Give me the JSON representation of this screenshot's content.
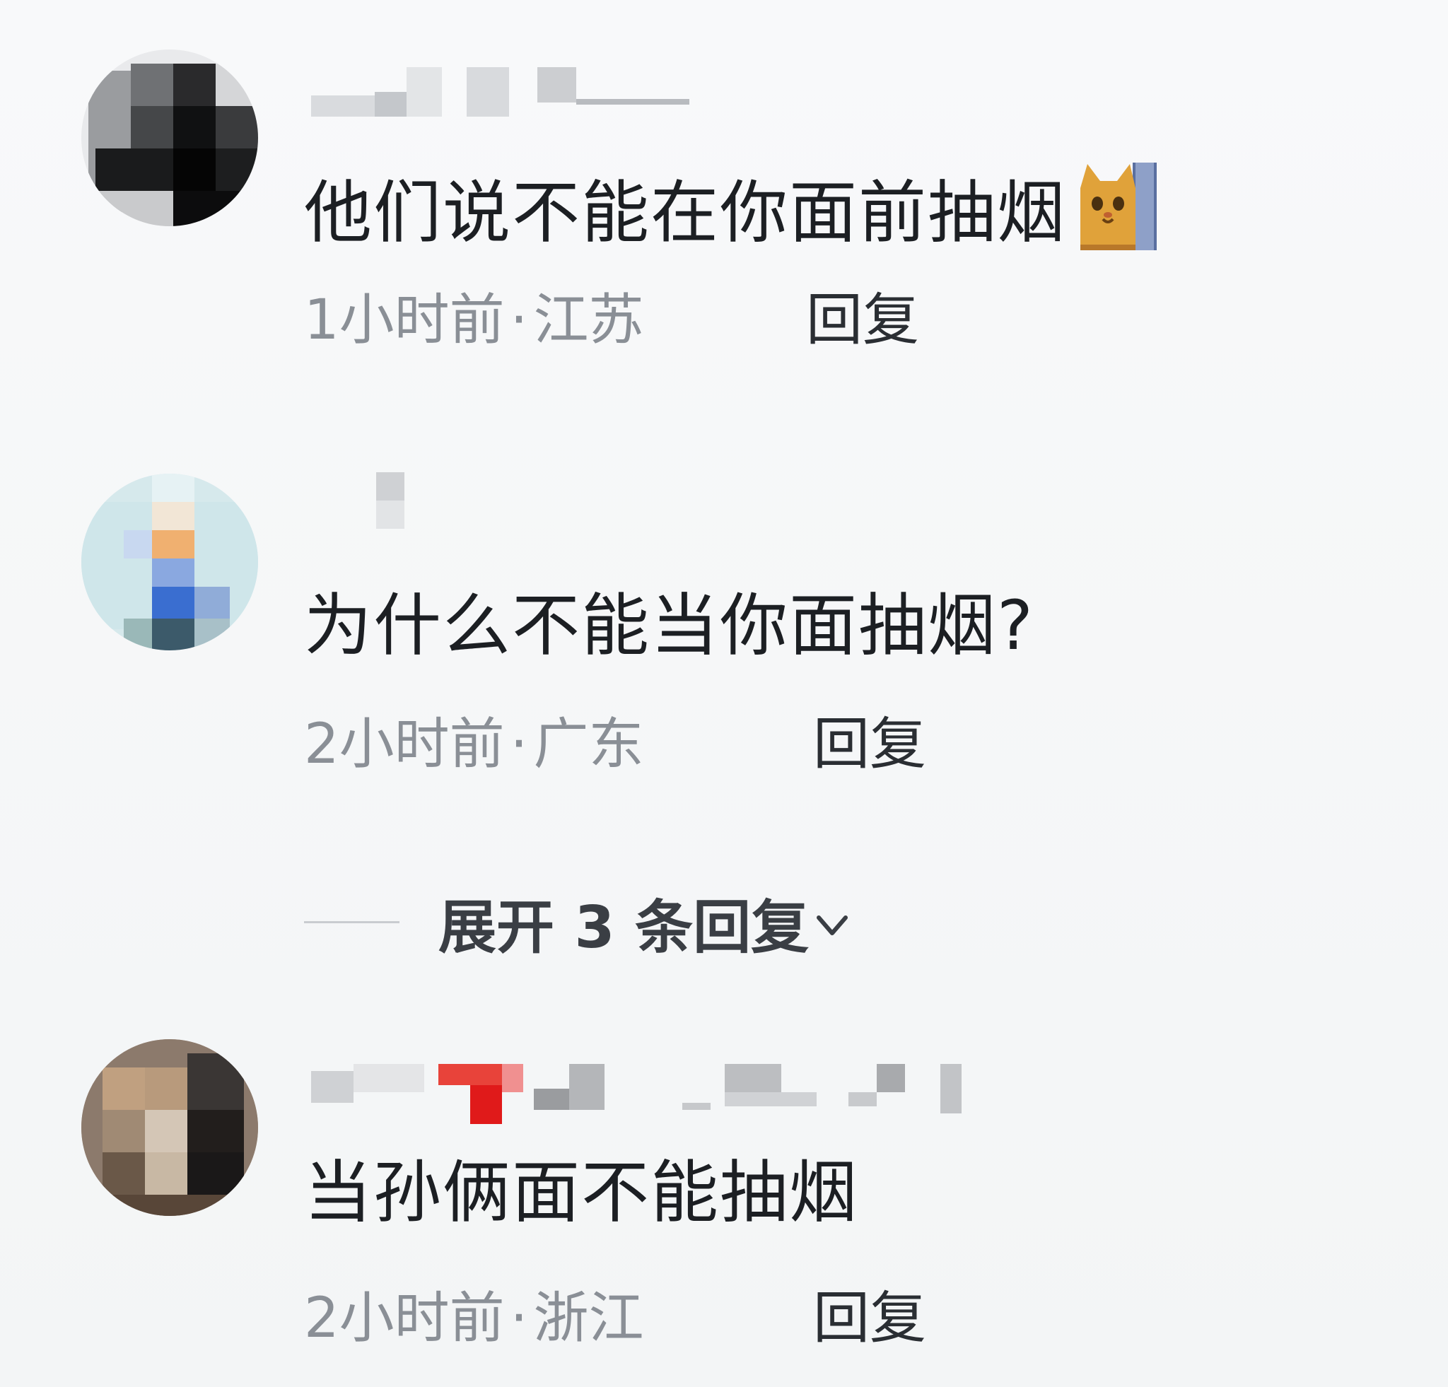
{
  "comments": [
    {
      "text": "他们说不能在你面前抽烟",
      "emoji": "cat-face-emoji",
      "time": "1小时前",
      "separator": "·",
      "location": "江苏",
      "reply_label": "回复"
    },
    {
      "text": "为什么不能当你面抽烟?",
      "time": "2小时前",
      "separator": "·",
      "location": "广东",
      "reply_label": "回复"
    },
    {
      "text": "当孙俩面不能抽烟",
      "time": "2小时前",
      "separator": "·",
      "location": "浙江",
      "reply_label": "回复"
    }
  ],
  "expand": {
    "label": "展开 3 条回复",
    "icon": "chevron-down-icon"
  },
  "colors": {
    "background": "#f6f7f8",
    "text": "#1c1f23",
    "meta": "#8a8f96",
    "reply": "#2a2e33"
  }
}
